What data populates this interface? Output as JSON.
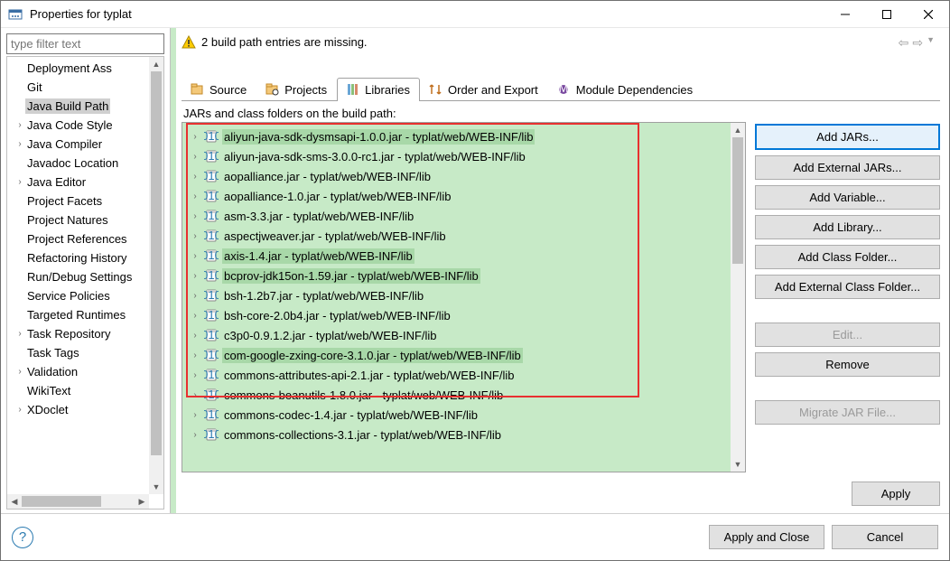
{
  "window": {
    "title": "Properties for typlat"
  },
  "filter_placeholder": "type filter text",
  "sidebar": {
    "items": [
      {
        "label": "Deployment Ass",
        "exp": false
      },
      {
        "label": "Git",
        "exp": false
      },
      {
        "label": "Java Build Path",
        "exp": false,
        "selected": true
      },
      {
        "label": "Java Code Style",
        "exp": true
      },
      {
        "label": "Java Compiler",
        "exp": true
      },
      {
        "label": "Javadoc Location",
        "exp": false
      },
      {
        "label": "Java Editor",
        "exp": true
      },
      {
        "label": "Project Facets",
        "exp": false
      },
      {
        "label": "Project Natures",
        "exp": false
      },
      {
        "label": "Project References",
        "exp": false
      },
      {
        "label": "Refactoring History",
        "exp": false
      },
      {
        "label": "Run/Debug Settings",
        "exp": false
      },
      {
        "label": "Service Policies",
        "exp": false
      },
      {
        "label": "Targeted Runtimes",
        "exp": false
      },
      {
        "label": "Task Repository",
        "exp": true
      },
      {
        "label": "Task Tags",
        "exp": false
      },
      {
        "label": "Validation",
        "exp": true
      },
      {
        "label": "WikiText",
        "exp": false
      },
      {
        "label": "XDoclet",
        "exp": true
      }
    ]
  },
  "message": "2 build path entries are missing.",
  "tabs": [
    {
      "label": "Source",
      "icon": "source"
    },
    {
      "label": "Projects",
      "icon": "projects"
    },
    {
      "label": "Libraries",
      "icon": "libraries",
      "active": true
    },
    {
      "label": "Order and Export",
      "icon": "order"
    },
    {
      "label": "Module Dependencies",
      "icon": "module"
    }
  ],
  "subheading": "JARs and class folders on the build path:",
  "jars": [
    {
      "t": "aliyun-java-sdk-dysmsapi-1.0.0.jar - typlat/web/WEB-INF/lib",
      "sel": true
    },
    {
      "t": "aliyun-java-sdk-sms-3.0.0-rc1.jar - typlat/web/WEB-INF/lib"
    },
    {
      "t": "aopalliance.jar - typlat/web/WEB-INF/lib"
    },
    {
      "t": "aopalliance-1.0.jar - typlat/web/WEB-INF/lib"
    },
    {
      "t": "asm-3.3.jar - typlat/web/WEB-INF/lib"
    },
    {
      "t": "aspectjweaver.jar - typlat/web/WEB-INF/lib"
    },
    {
      "t": "axis-1.4.jar - typlat/web/WEB-INF/lib",
      "sel": true
    },
    {
      "t": "bcprov-jdk15on-1.59.jar - typlat/web/WEB-INF/lib",
      "sel": true
    },
    {
      "t": "bsh-1.2b7.jar - typlat/web/WEB-INF/lib"
    },
    {
      "t": "bsh-core-2.0b4.jar - typlat/web/WEB-INF/lib"
    },
    {
      "t": "c3p0-0.9.1.2.jar - typlat/web/WEB-INF/lib"
    },
    {
      "t": "com-google-zxing-core-3.1.0.jar - typlat/web/WEB-INF/lib",
      "sel": true
    },
    {
      "t": "commons-attributes-api-2.1.jar - typlat/web/WEB-INF/lib"
    },
    {
      "t": "commons-beanutils-1.8.0.jar - typlat/web/WEB-INF/lib"
    },
    {
      "t": "commons-codec-1.4.jar - typlat/web/WEB-INF/lib"
    },
    {
      "t": "commons-collections-3.1.jar - typlat/web/WEB-INF/lib"
    }
  ],
  "buttons": {
    "add_jars": "Add JARs...",
    "add_ext_jars": "Add External JARs...",
    "add_var": "Add Variable...",
    "add_lib": "Add Library...",
    "add_cf": "Add Class Folder...",
    "add_ecf": "Add External Class Folder...",
    "edit": "Edit...",
    "remove": "Remove",
    "migrate": "Migrate JAR File...",
    "apply": "Apply",
    "apply_close": "Apply and Close",
    "cancel": "Cancel"
  }
}
